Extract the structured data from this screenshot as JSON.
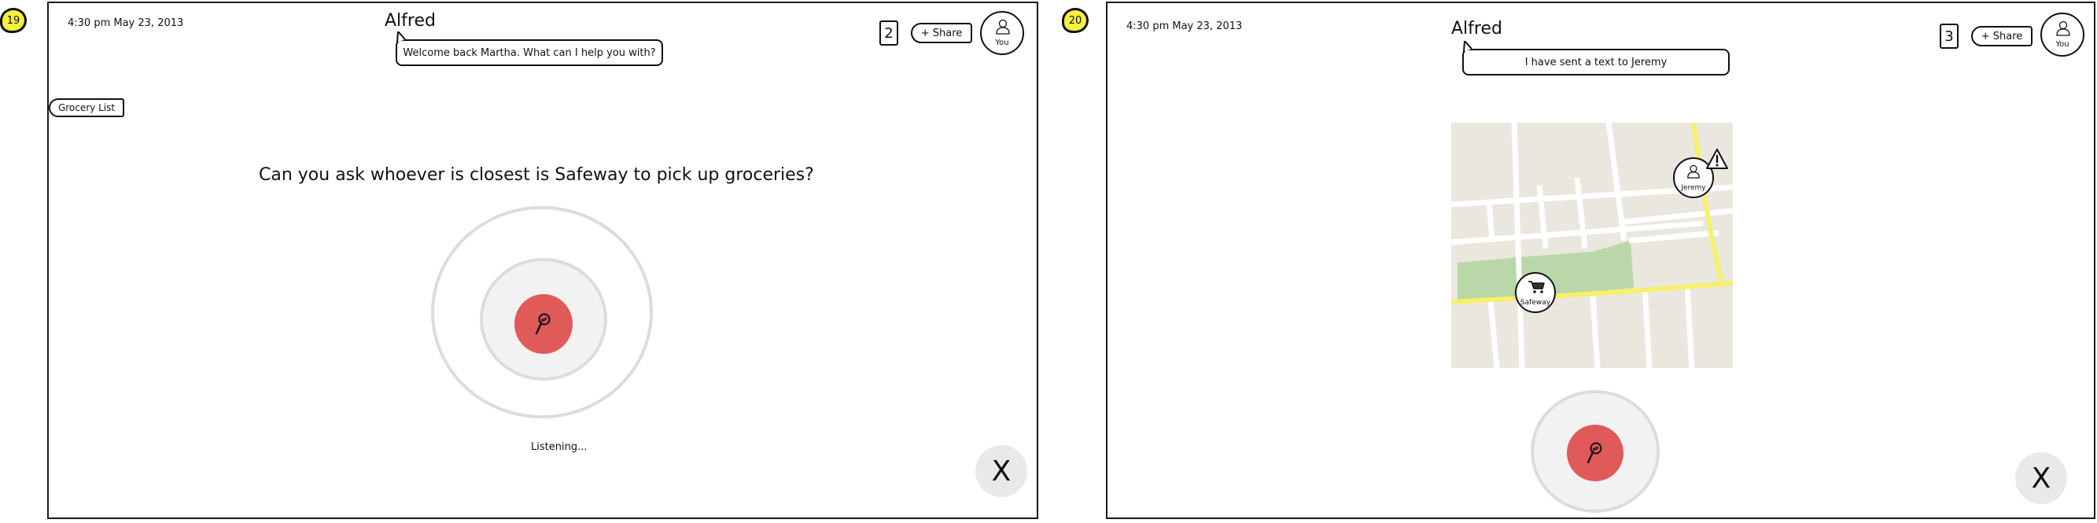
{
  "screens": [
    {
      "step_number": "19",
      "timestamp": "4:30 pm May 23, 2013",
      "app_title": "Alfred",
      "assistant_message": "Welcome back Martha. What can I help you with?",
      "participant_count": "2",
      "share_label": "+ Share",
      "avatar_label": "You",
      "tag_label": "Grocery List",
      "spoken_query": "Can you ask whoever is closest is Safeway to pick up groceries?",
      "status_text": "Listening...",
      "close_label": "X"
    },
    {
      "step_number": "20",
      "timestamp": "4:30 pm May 23, 2013",
      "app_title": "Alfred",
      "assistant_message": "I have sent a text to Jeremy",
      "participant_count": "3",
      "share_label": "+ Share",
      "avatar_label": "You",
      "map": {
        "pins": [
          {
            "label": "Jeremy",
            "icon": "person-icon"
          },
          {
            "label": "Safeway",
            "icon": "cart-icon"
          }
        ],
        "alert_icon": "warning-icon"
      },
      "close_label": "X"
    }
  ],
  "colors": {
    "accent_yellow": "#f5f03c",
    "mic_red": "#e05a5a",
    "ring_gray": "#dcdcdc",
    "map_bg": "#eae7df",
    "park_green": "#b9d7a8",
    "road_yellow": "#f7f06a"
  }
}
